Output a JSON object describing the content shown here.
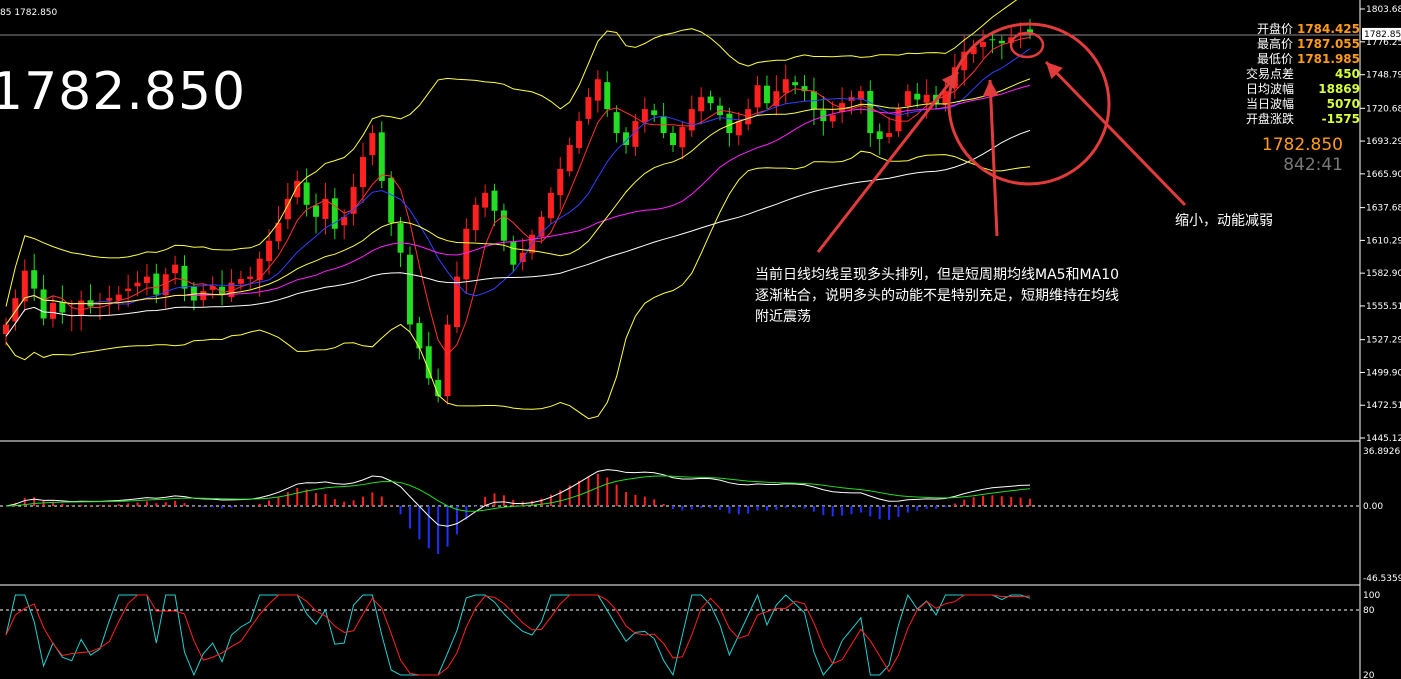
{
  "header": {
    "text": "85 1782.850"
  },
  "current_price_big": "1782.850",
  "stats": [
    {
      "label": "开盘价",
      "value": "1784.425",
      "tone": "orange"
    },
    {
      "label": "最高价",
      "value": "1787.055",
      "tone": "orange"
    },
    {
      "label": "最低价",
      "value": "1781.985",
      "tone": "orange"
    },
    {
      "label": "交易点差",
      "value": "450",
      "tone": "green"
    },
    {
      "label": "日均波幅",
      "value": "18869",
      "tone": "green"
    },
    {
      "label": "当日波幅",
      "value": "5070",
      "tone": "green"
    },
    {
      "label": "开盘涨跌",
      "value": "-1575",
      "tone": "green"
    }
  ],
  "price_display": {
    "price": "1782.850",
    "countdown": "842:41"
  },
  "annotations": {
    "main_note": "当前日线均线呈现多头排列，但是短周期均线MA5和MA10逐渐粘合，说明多头的动能不是特别充足，短期维持在均线附近震荡",
    "shrink_note": "缩小，动能减弱"
  },
  "colors": {
    "bull": "#ff2020",
    "bear": "#22dd22",
    "ma_short": "#ff3030",
    "ma_blue": "#3040ff",
    "ma_magenta": "#ff20ff",
    "ma_white": "#ffffff",
    "band": "#ffff40",
    "annotation": "#e23b3b",
    "stat_orange": "#ff9b1a",
    "stat_green": "#d8ff3c"
  },
  "chart_data": {
    "type": "candlestick",
    "price_axis_ticks": [
      "1803.680",
      "1776.250",
      "1748.790",
      "1720.680",
      "1693.290",
      "1665.900",
      "1637.680",
      "1610.290",
      "1582.900",
      "1555.510",
      "1527.290",
      "1499.900",
      "1472.510",
      "1445.120"
    ],
    "current_price": 1782.85,
    "open": 1784.425,
    "high": 1787.055,
    "low": 1781.985,
    "macd_axis_ticks": [
      "36.8926",
      "0.00",
      "-46.5359"
    ],
    "stoch_axis_ticks": [
      "100",
      "80",
      "20"
    ],
    "closes": [
      1540,
      1562,
      1585,
      1570,
      1545,
      1558,
      1550,
      1548,
      1560,
      1555,
      1558,
      1562,
      1565,
      1570,
      1575,
      1580,
      1565,
      1582,
      1590,
      1570,
      1560,
      1568,
      1572,
      1565,
      1575,
      1578,
      1580,
      1595,
      1610,
      1625,
      1645,
      1660,
      1640,
      1630,
      1645,
      1620,
      1630,
      1655,
      1680,
      1700,
      1660,
      1625,
      1600,
      1540,
      1520,
      1495,
      1480,
      1540,
      1580,
      1620,
      1640,
      1650,
      1635,
      1610,
      1590,
      1600,
      1615,
      1630,
      1650,
      1670,
      1690,
      1710,
      1730,
      1745,
      1720,
      1700,
      1690,
      1710,
      1720,
      1715,
      1700,
      1690,
      1705,
      1720,
      1730,
      1725,
      1715,
      1700,
      1710,
      1720,
      1740,
      1725,
      1735,
      1745,
      1740,
      1735,
      1720,
      1710,
      1715,
      1725,
      1730,
      1735,
      1700,
      1695,
      1700,
      1720,
      1735,
      1728,
      1732,
      1725,
      1735,
      1755,
      1768,
      1772,
      1776,
      1778,
      1775,
      1780,
      1784,
      1782.85
    ]
  }
}
